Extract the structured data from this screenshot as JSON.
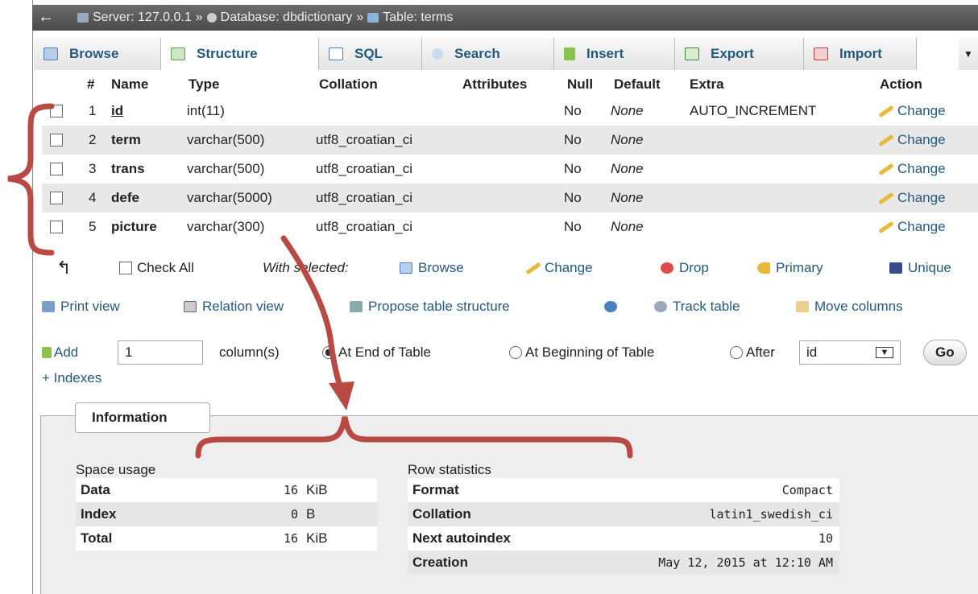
{
  "breadcrumb": {
    "back": "←",
    "server": "Server: 127.0.0.1",
    "sep1": "»",
    "database": "Database: dbdictionary",
    "sep2": "»",
    "table": "Table: terms"
  },
  "tabs": [
    {
      "label": "Browse",
      "icon": "browse-icon",
      "color": "#4a7fc0"
    },
    {
      "label": "Structure",
      "icon": "structure-icon",
      "color": "#5aa04a"
    },
    {
      "label": "SQL",
      "icon": "sql-icon",
      "color": "#4a7fc0"
    },
    {
      "label": "Search",
      "icon": "search-icon",
      "color": "#3c78c8"
    },
    {
      "label": "Insert",
      "icon": "insert-icon",
      "color": "#3a8a3a"
    },
    {
      "label": "Export",
      "icon": "export-icon",
      "color": "#3a8a3a"
    },
    {
      "label": "Import",
      "icon": "import-icon",
      "color": "#c83a3a"
    }
  ],
  "structure": {
    "headers": {
      "num": "#",
      "name": "Name",
      "type": "Type",
      "collation": "Collation",
      "attributes": "Attributes",
      "null": "Null",
      "default": "Default",
      "extra": "Extra",
      "action": "Action"
    },
    "rows": [
      {
        "num": "1",
        "name": "id",
        "type": "int(11)",
        "collation": "",
        "null": "No",
        "default": "None",
        "extra": "AUTO_INCREMENT",
        "action": "Change"
      },
      {
        "num": "2",
        "name": "term",
        "type": "varchar(500)",
        "collation": "utf8_croatian_ci",
        "null": "No",
        "default": "None",
        "extra": "",
        "action": "Change"
      },
      {
        "num": "3",
        "name": "trans",
        "type": "varchar(500)",
        "collation": "utf8_croatian_ci",
        "null": "No",
        "default": "None",
        "extra": "",
        "action": "Change"
      },
      {
        "num": "4",
        "name": "defe",
        "type": "varchar(5000)",
        "collation": "utf8_croatian_ci",
        "null": "No",
        "default": "None",
        "extra": "",
        "action": "Change"
      },
      {
        "num": "5",
        "name": "picture",
        "type": "varchar(300)",
        "collation": "utf8_croatian_ci",
        "null": "No",
        "default": "None",
        "extra": "",
        "action": "Change"
      }
    ]
  },
  "with_selected": {
    "check_all": "Check All",
    "label": "With selected:",
    "browse": "Browse",
    "change": "Change",
    "drop": "Drop",
    "primary": "Primary",
    "unique": "Unique"
  },
  "links": {
    "print_view": "Print view",
    "relation_view": "Relation view",
    "propose": "Propose table structure",
    "track": "Track table",
    "move": "Move columns"
  },
  "add_column": {
    "add": "Add",
    "count": "1",
    "columns": "column(s)",
    "at_end": "At End of Table",
    "at_beginning": "At Beginning of Table",
    "after": "After",
    "after_field": "id",
    "go": "Go"
  },
  "indexes": "+ Indexes",
  "information": {
    "legend": "Information",
    "space": {
      "title": "Space usage",
      "rows": [
        {
          "label": "Data",
          "value": "16",
          "unit": "KiB"
        },
        {
          "label": "Index",
          "value": "0",
          "unit": "B"
        },
        {
          "label": "Total",
          "value": "16",
          "unit": "KiB"
        }
      ]
    },
    "stats": {
      "title": "Row statistics",
      "rows": [
        {
          "label": "Format",
          "value": "Compact"
        },
        {
          "label": "Collation",
          "value": "latin1_swedish_ci"
        },
        {
          "label": "Next autoindex",
          "value": "10"
        },
        {
          "label": "Creation",
          "value": "May 12, 2015 at 12:10 AM"
        }
      ]
    }
  },
  "colors": {
    "link": "#235a81",
    "annotation": "#b84a43"
  }
}
